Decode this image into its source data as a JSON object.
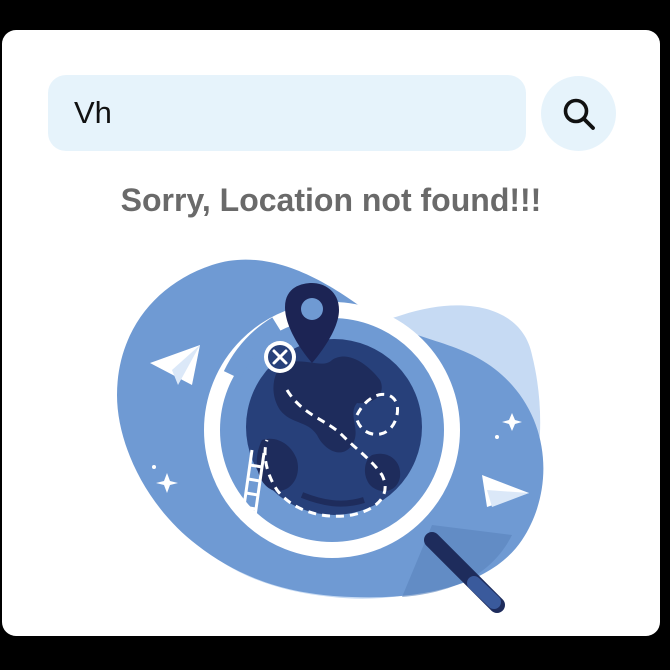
{
  "search": {
    "value": "Vh",
    "button_icon": "search-icon"
  },
  "message": {
    "text": "Sorry, Location not found!!!"
  },
  "illustration": {
    "icon": "location-not-found-illustration"
  },
  "colors": {
    "input_background": "#e6f3fb",
    "message_text": "#6a6a6a",
    "blob_primary": "#6f9ad3",
    "blob_light": "#c6daf3",
    "globe": "#27407a",
    "globe_dark": "#1e2c5c",
    "pin": "#1c2454"
  }
}
